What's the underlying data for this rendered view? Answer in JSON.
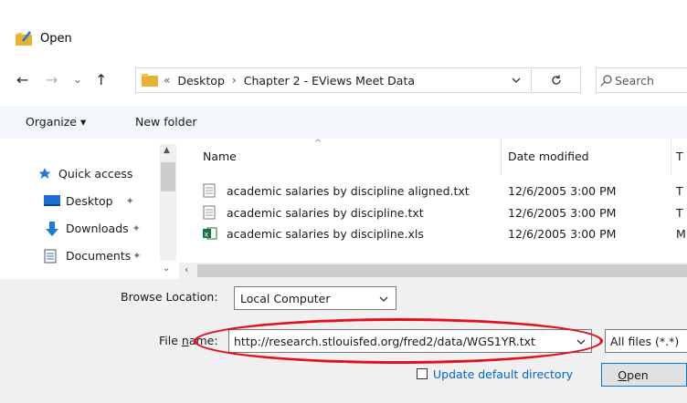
{
  "window": {
    "title": "Open"
  },
  "nav": {
    "back": "←",
    "forward": "→",
    "recent": "⌄",
    "up": "↑",
    "crumbs": [
      "Desktop",
      "Chapter 2 - EViews Meet Data"
    ],
    "crumb_prefix": "«",
    "crumb_separator": "›",
    "search_placeholder": "Search"
  },
  "toolbar": {
    "organize": "Organize ▾",
    "new_folder": "New folder"
  },
  "sidebar": {
    "items": [
      {
        "label": "Quick access",
        "icon": "star-icon"
      },
      {
        "label": "Desktop",
        "icon": "desktop-icon"
      },
      {
        "label": "Downloads",
        "icon": "download-icon"
      },
      {
        "label": "Documents",
        "icon": "documents-icon"
      }
    ]
  },
  "columns": {
    "name": "Name",
    "date": "Date modified",
    "type": "T"
  },
  "files": [
    {
      "name": "academic salaries by discipline aligned.txt",
      "date": "12/6/2005 3:00 PM",
      "type": "T",
      "icon": "text-file-icon"
    },
    {
      "name": "academic salaries by discipline.txt",
      "date": "12/6/2005 3:00 PM",
      "type": "T",
      "icon": "text-file-icon"
    },
    {
      "name": "academic salaries by discipline.xls",
      "date": "12/6/2005 3:00 PM",
      "type": "M",
      "icon": "excel-file-icon"
    }
  ],
  "bottom": {
    "browse_location_label": "Browse Location:",
    "browse_location_value": "Local Computer",
    "file_name_label_pre": "File ",
    "file_name_label_u": "n",
    "file_name_label_post": "ame:",
    "file_name_value": "http://research.stlouisfed.org/fred2/data/WGS1YR.txt",
    "file_type_value": "All files (*.*)",
    "update_default_label": "Update default directory",
    "open_button_u": "O",
    "open_button_post": "pen"
  },
  "colors": {
    "annotation_oval": "#e0121f",
    "link_blue": "#0066cc",
    "toolbar_bg": "#f3f7fb"
  }
}
